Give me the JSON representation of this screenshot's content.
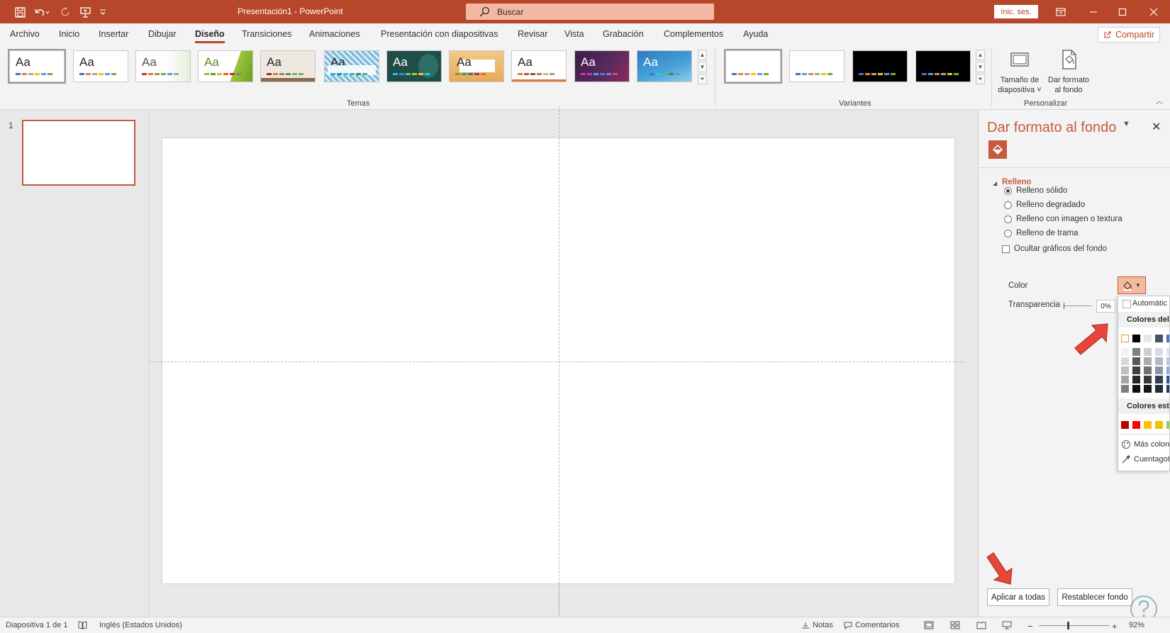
{
  "titlebar": {
    "title": "Presentación1  -  PowerPoint",
    "search_placeholder": "Buscar",
    "signin_label": "Inic. ses.",
    "qat_icons": [
      "save-icon",
      "undo-icon",
      "redo-icon",
      "start-slideshow-icon",
      "customize-qat-icon"
    ],
    "window_buttons": [
      "ribbon-display-icon",
      "minimize-icon",
      "maximize-icon",
      "close-icon"
    ]
  },
  "menu": {
    "tabs": [
      "Archivo",
      "Inicio",
      "Insertar",
      "Dibujar",
      "Diseño",
      "Transiciones",
      "Animaciones",
      "Presentación con diapositivas",
      "Revisar",
      "Vista",
      "Grabación",
      "Complementos",
      "Ayuda"
    ],
    "active_tab": "Diseño",
    "share_label": "Compartir"
  },
  "ribbon": {
    "themes_label": "Temas",
    "theme_sample_text": "Aa",
    "variants_label": "Variantes",
    "customize_label": "Personalizar",
    "slide_size_label_1": "Tamaño de",
    "slide_size_label_2": "diapositiva",
    "format_bg_label_1": "Dar formato",
    "format_bg_label_2": "al fondo"
  },
  "thumbnails": {
    "slide_number": "1"
  },
  "format_pane": {
    "title": "Dar formato al fondo",
    "section": "Relleno",
    "options": [
      "Relleno sólido",
      "Relleno degradado",
      "Relleno con imagen o textura",
      "Relleno de trama"
    ],
    "selected_option": "Relleno sólido",
    "hide_graphics_label": "Ocultar gráficos del fondo",
    "color_label": "Color",
    "transparency_label": "Transparencia",
    "transparency_value": "0%",
    "apply_all_label": "Aplicar a todas",
    "reset_label": "Restablecer fondo"
  },
  "color_dropdown": {
    "automatic_label": "Automátic",
    "theme_colors_label": "Colores del",
    "standard_colors_label": "Colores está",
    "more_colors_label": "Más colore",
    "eyedropper_label": "Cuentagot"
  },
  "statusbar": {
    "slide_info": "Diapositiva 1 de 1",
    "language": "Inglés (Estados Unidos)",
    "notes_label": "Notas",
    "comments_label": "Comentarios",
    "zoom": "92%"
  },
  "colors": {
    "accent": "#b7472a",
    "pane_accent": "#c55a3c",
    "arrow_red": "#e8453c"
  }
}
